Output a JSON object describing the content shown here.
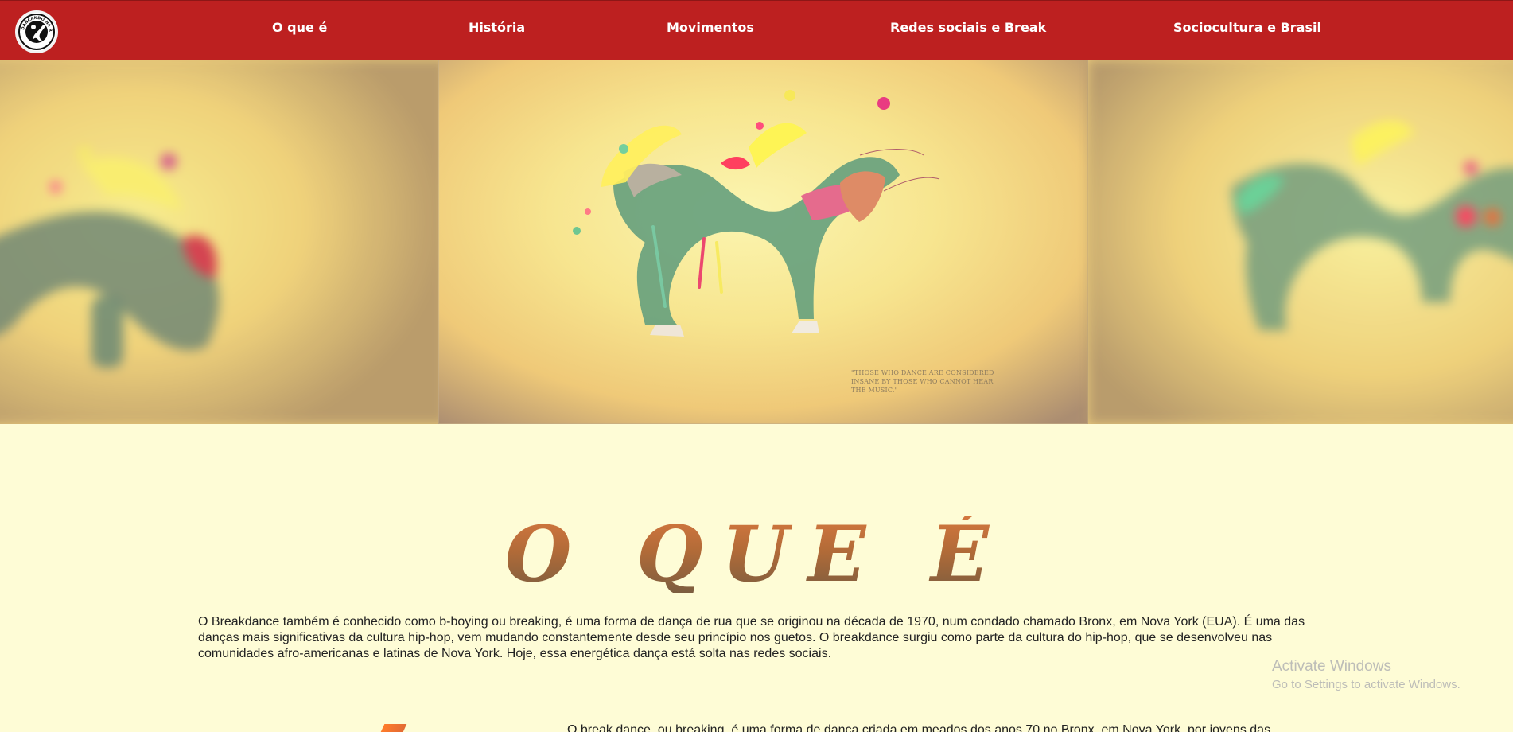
{
  "window": {
    "title": "Dançando na rede"
  },
  "brand": {
    "logo_text": "DANÇANDO NA REDE",
    "logo_icon": "dancer-icon"
  },
  "nav": {
    "items": [
      {
        "label": "O que é"
      },
      {
        "label": "História"
      },
      {
        "label": "Movimentos"
      },
      {
        "label": "Redes sociais e Break"
      },
      {
        "label": "Sociocultura e Brasil"
      }
    ]
  },
  "hero": {
    "quote": "\"THOSE WHO DANCE ARE CONSIDERED INSANE BY THOSE WHO CANNOT HEAR THE MUSIC.\""
  },
  "content": {
    "section_title": "O que é",
    "intro_text": "O Breakdance também é conhecido como b-boying ou breaking, é uma forma de dança de rua que se originou na década de 1970, num condado chamado Bronx, em Nova York (EUA). É uma das danças mais significativas da cultura hip-hop, vem mudando constantemente desde seu princípio nos guetos. O breakdance surgiu como parte da cultura do hip-hop, que se desenvolveu nas comunidades afro-americanas e latinas de Nova York. Hoje, essa energética dança está solta nas redes sociais.",
    "next_text": "O break dance, ou breaking, é uma forma de dança criada em meados dos anos 70 no Bronx, em Nova York, por jovens das"
  },
  "windows_notice": {
    "title": "Activate Windows",
    "subtitle": "Go to Settings to activate Windows."
  },
  "colors": {
    "nav_bg": "#bd2020",
    "page_bg": "#fefcd6",
    "title_gradient_top": "#d3773e",
    "title_gradient_bottom": "#7c5d3f"
  }
}
